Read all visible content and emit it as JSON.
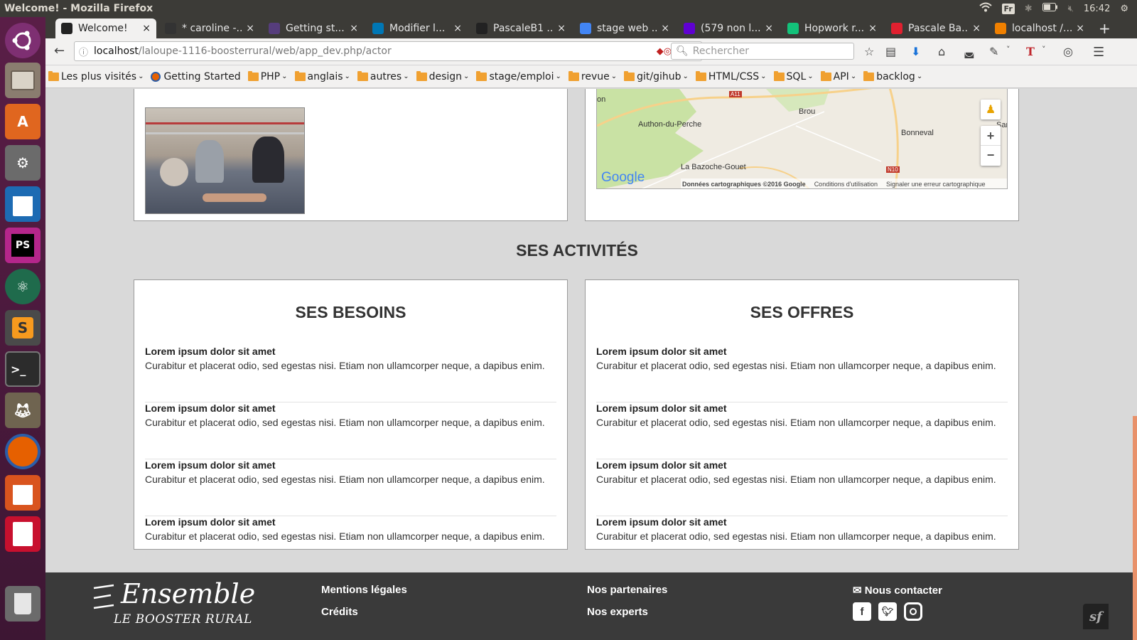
{
  "top_panel": {
    "title": "Welcome! - Mozilla Firefox",
    "lang": "Fr",
    "clock": "16:42"
  },
  "tabs": [
    {
      "label": "Welcome!",
      "icon": "symfony-icon",
      "color": "#222222"
    },
    {
      "label": "* caroline -...",
      "icon": "sync-icon",
      "color": "#333333"
    },
    {
      "label": "Getting st...",
      "icon": "bootstrap-icon",
      "color": "#563d7c"
    },
    {
      "label": "Modifier l...",
      "icon": "linkedin-icon",
      "color": "#0077b5"
    },
    {
      "label": "PascaleB1 ...",
      "icon": "github-icon",
      "color": "#222222"
    },
    {
      "label": "stage web ...",
      "icon": "google-icon",
      "color": "#4285f4"
    },
    {
      "label": "(579 non l...",
      "icon": "yahoo-mail-icon",
      "color": "#5f01d1"
    },
    {
      "label": "Hopwork r...",
      "icon": "hopwork-icon",
      "color": "#13c27a"
    },
    {
      "label": "Pascale Ba...",
      "icon": "red-app-icon",
      "color": "#e0202f"
    },
    {
      "label": "localhost /...",
      "icon": "phpmyadmin-icon",
      "color": "#f08000"
    }
  ],
  "new_tab": "+",
  "url": {
    "host": "localhost",
    "path": "/laloupe-1116-boosterrural/web/app_dev.php/actor"
  },
  "search_placeholder": "Rechercher",
  "bookmarks": [
    {
      "label": "Les plus visités",
      "folder": true,
      "caret": true
    },
    {
      "label": "Getting Started",
      "folder": false,
      "caret": false
    },
    {
      "label": "PHP",
      "folder": true,
      "caret": true
    },
    {
      "label": "anglais",
      "folder": true,
      "caret": true
    },
    {
      "label": "autres",
      "folder": true,
      "caret": true
    },
    {
      "label": "design",
      "folder": true,
      "caret": true
    },
    {
      "label": "stage/emploi",
      "folder": true,
      "caret": true
    },
    {
      "label": "revue",
      "folder": true,
      "caret": true
    },
    {
      "label": "git/gihub",
      "folder": true,
      "caret": true
    },
    {
      "label": "HTML/CSS",
      "folder": true,
      "caret": true
    },
    {
      "label": "SQL",
      "folder": true,
      "caret": true
    },
    {
      "label": "API",
      "folder": true,
      "caret": true
    },
    {
      "label": "backlog",
      "folder": true,
      "caret": true
    }
  ],
  "map": {
    "labels": [
      "Authon-du-Perche",
      "Brou",
      "Bonneval",
      "La Bazoche-Gouet",
      "on",
      "Sar"
    ],
    "road_labels": [
      "A11",
      "N10"
    ],
    "google": "Google",
    "copyright": "Données cartographiques ©2016 Google",
    "terms": "Conditions d'utilisation",
    "report": "Signaler une erreur cartographique",
    "zoom_in": "+",
    "zoom_out": "−"
  },
  "activities_title": "SES ACTIVITÉS",
  "besoins": {
    "title": "SES BESOINS",
    "items": [
      {
        "title": "Lorem ipsum dolor sit amet",
        "desc": "Curabitur et placerat odio, sed egestas nisi. Etiam non ullamcorper neque, a dapibus enim."
      },
      {
        "title": "Lorem ipsum dolor sit amet",
        "desc": "Curabitur et placerat odio, sed egestas nisi. Etiam non ullamcorper neque, a dapibus enim."
      },
      {
        "title": "Lorem ipsum dolor sit amet",
        "desc": "Curabitur et placerat odio, sed egestas nisi. Etiam non ullamcorper neque, a dapibus enim."
      },
      {
        "title": "Lorem ipsum dolor sit amet",
        "desc": "Curabitur et placerat odio, sed egestas nisi. Etiam non ullamcorper neque, a dapibus enim."
      }
    ]
  },
  "offres": {
    "title": "SES OFFRES",
    "items": [
      {
        "title": "Lorem ipsum dolor sit amet",
        "desc": "Curabitur et placerat odio, sed egestas nisi. Etiam non ullamcorper neque, a dapibus enim."
      },
      {
        "title": "Lorem ipsum dolor sit amet",
        "desc": "Curabitur et placerat odio, sed egestas nisi. Etiam non ullamcorper neque, a dapibus enim."
      },
      {
        "title": "Lorem ipsum dolor sit amet",
        "desc": "Curabitur et placerat odio, sed egestas nisi. Etiam non ullamcorper neque, a dapibus enim."
      },
      {
        "title": "Lorem ipsum dolor sit amet",
        "desc": "Curabitur et placerat odio, sed egestas nisi. Etiam non ullamcorper neque, a dapibus enim."
      }
    ]
  },
  "footer": {
    "logo_main": "Ensemble",
    "logo_sub": "LE BOOSTER RURAL",
    "mentions": "Mentions légales",
    "credits": "Crédits",
    "partenaires": "Nos partenaires",
    "experts": "Nos experts",
    "contact": "Nous contacter"
  },
  "colors": {
    "launcher": "#4a1c3c",
    "footer": "#3a3a3a",
    "scroll_accent": "#e8916a"
  }
}
